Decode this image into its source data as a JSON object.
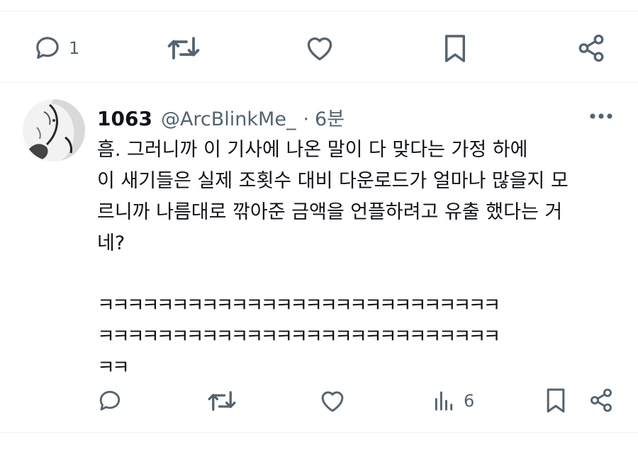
{
  "top_actions": {
    "reply_count": "1"
  },
  "tweet": {
    "display_name": "1063",
    "handle": "@ArcBlinkMe_",
    "separator": "·",
    "time": "6분",
    "lines": [
      "흠. 그러니까 이 기사에 나온 말이 다 맞다는 가정 하에",
      "이 새기들은 실제 조횟수 대비 다운로드가 얼마나 많을지 모",
      "르니까 나름대로 깎아준 금액을 언플하려고 유출 했다는 거",
      "네?",
      "",
      "ㅋㅋㅋㅋㅋㅋㅋㅋㅋㅋㅋㅋㅋㅋㅋㅋㅋㅋㅋㅋㅋㅋㅋㅋㅋㅋㅋ",
      "ㅋㅋㅋㅋㅋㅋㅋㅋㅋㅋㅋㅋㅋㅋㅋㅋㅋㅋㅋㅋㅋㅋㅋㅋㅋㅋㅋ",
      "ㅋㅋ"
    ],
    "views_count": "6"
  },
  "icons": {
    "reply": "speech-bubble-icon",
    "retweet": "retweet-icon",
    "like": "heart-icon",
    "bookmark": "bookmark-icon",
    "share": "share-icon",
    "views": "bar-chart-icon",
    "more": "more-dots-icon"
  },
  "colors": {
    "icon": "#536471",
    "text": "#0f1419",
    "divider": "#eff3f4"
  }
}
